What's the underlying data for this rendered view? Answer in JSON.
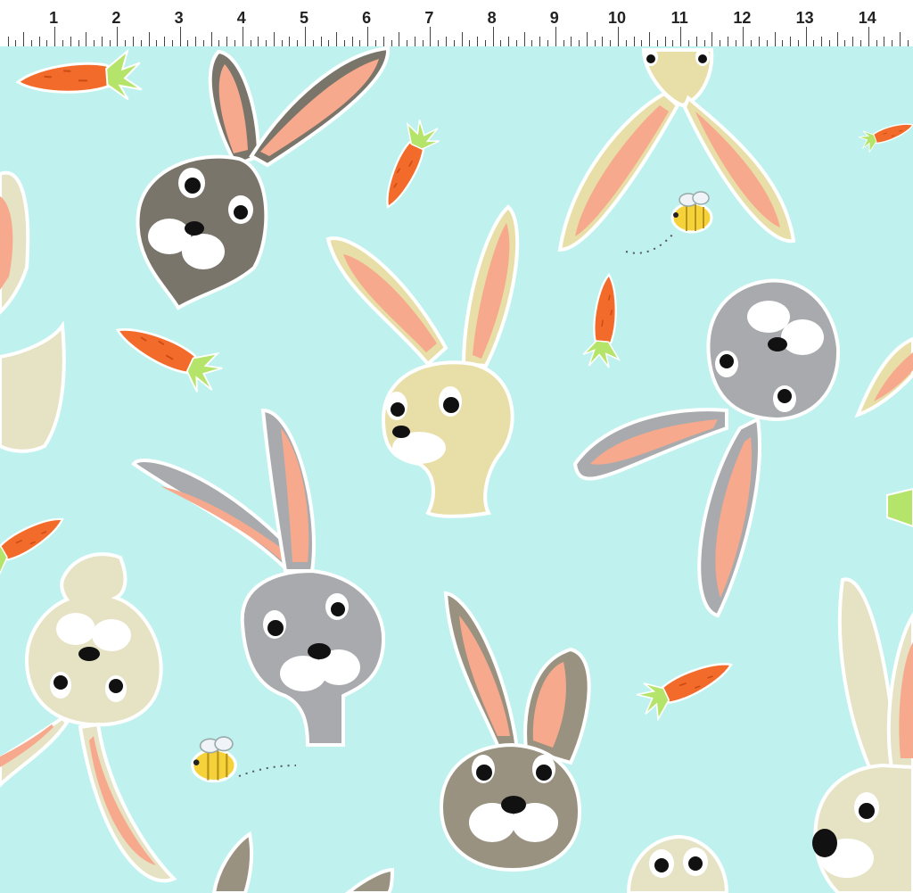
{
  "ruler": {
    "unit_labels": [
      "1",
      "2",
      "3",
      "4",
      "5",
      "6",
      "7",
      "8",
      "9",
      "10",
      "11",
      "12",
      "13",
      "14"
    ],
    "background": "#ffffff",
    "text_color": "#222222"
  },
  "fabric": {
    "background": "#bff2ee",
    "motifs": [
      "bunny-head-icon",
      "carrot-icon",
      "bee-icon"
    ],
    "palette": {
      "carrot": "#f36b2a",
      "carrot_leaf": "#b5e46b",
      "ear_inner": "#f7a98d",
      "bunny_dark": "#7a756a",
      "bunny_tan": "#e8dfa8",
      "bunny_gray": "#a8aaad",
      "bunny_cream": "#e6e2c4",
      "bee": "#f5d23a"
    }
  }
}
